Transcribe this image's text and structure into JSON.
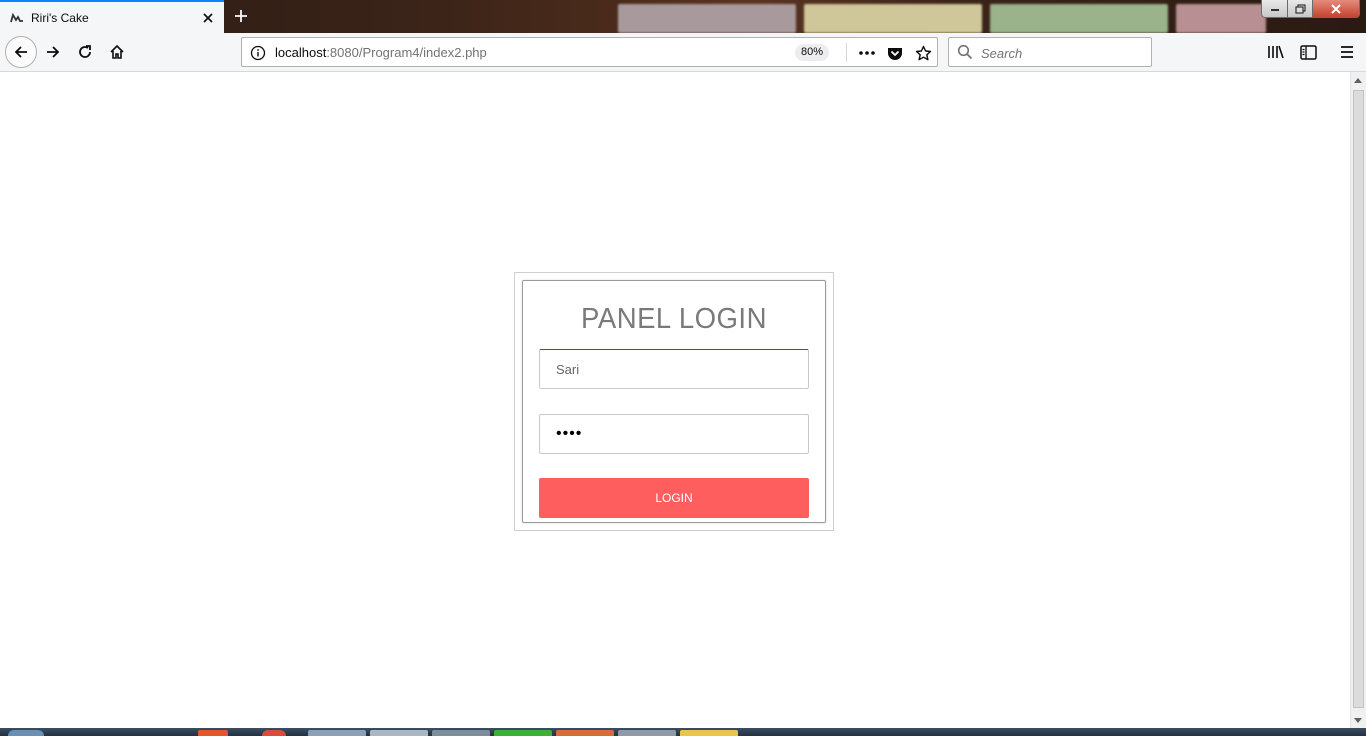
{
  "browser": {
    "tab_title": "Riri's Cake",
    "url_host": "localhost",
    "url_path": ":8080/Program4/index2.php",
    "zoom": "80%",
    "search_placeholder": "Search"
  },
  "login": {
    "title": "PANEL LOGIN",
    "username_value": "Sari",
    "password_value": "••••",
    "button_label": "LOGIN"
  },
  "colors": {
    "tab_accent": "#0a84ff",
    "login_button": "#ff5e5e",
    "field_accent": "#8b3a1a"
  },
  "icons": {
    "back": "arrow-left-icon",
    "forward": "arrow-right-icon",
    "reload": "reload-icon",
    "home": "home-icon",
    "info": "info-icon",
    "more": "ellipsis-icon",
    "pocket": "pocket-icon",
    "bookmark": "star-icon",
    "library": "library-icon",
    "sidebar": "sidebar-icon",
    "menu": "hamburger-icon"
  }
}
